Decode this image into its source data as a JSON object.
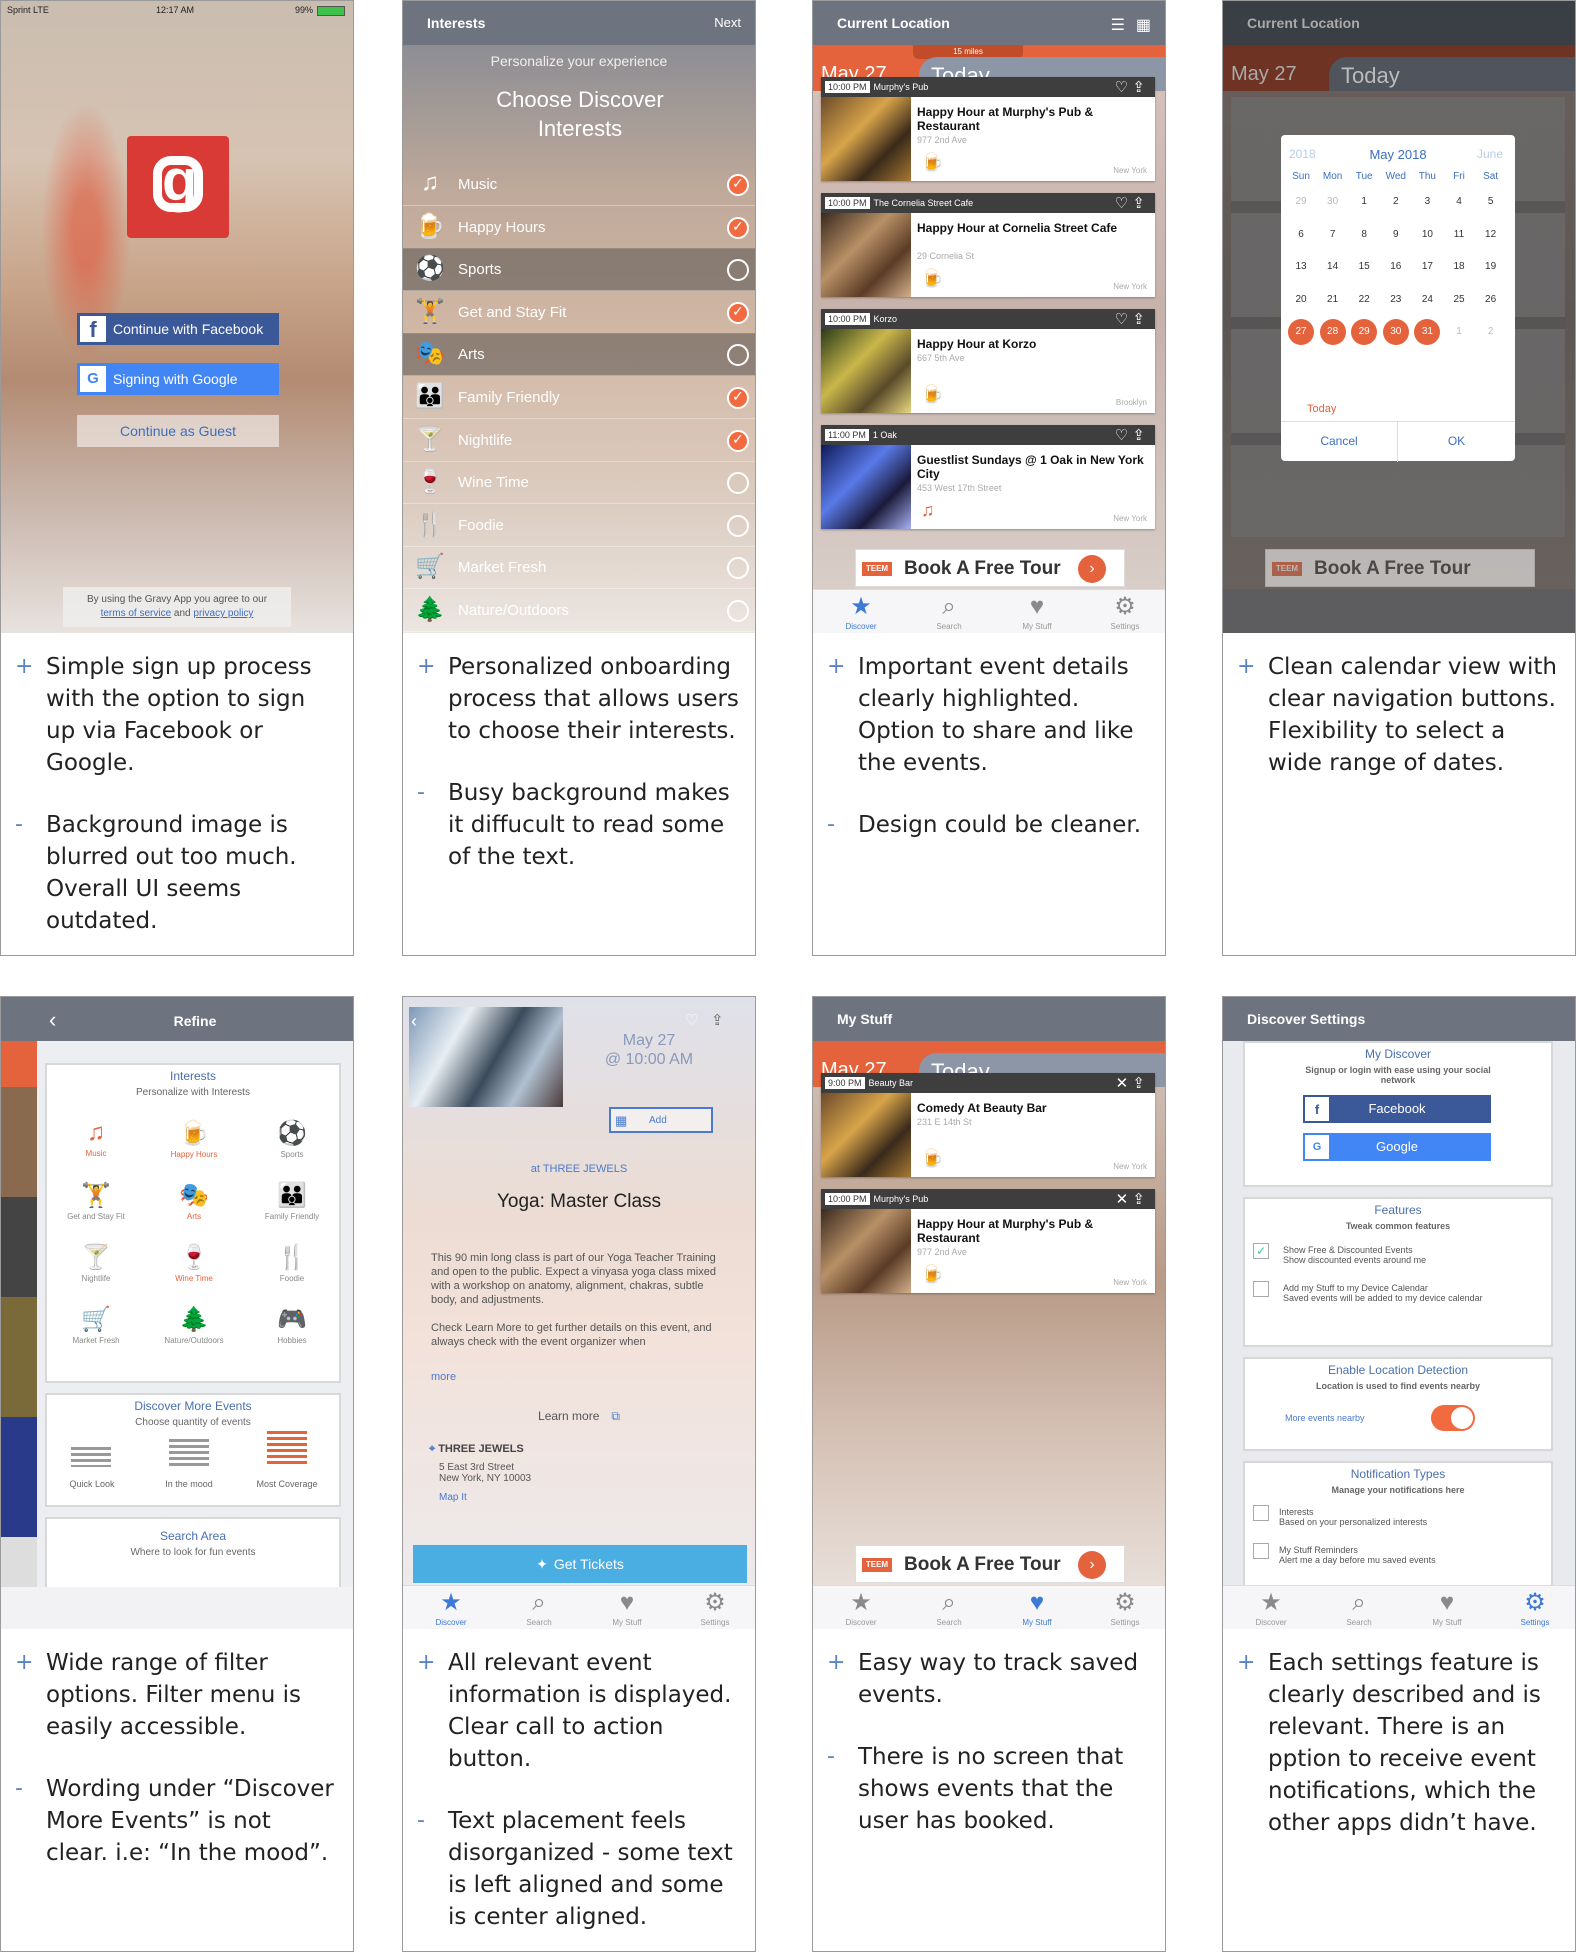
{
  "cards": [
    {
      "notes": [
        {
          "sym": "+",
          "text": "Simple sign up process with the option to sign up via Facebook or Google."
        },
        {
          "sym": "-",
          "text": "Background image is blurred out too much. Overall UI seems outdated."
        }
      ]
    },
    {
      "notes": [
        {
          "sym": "+",
          "text": "Personalized onboarding process that allows users to choose their interests."
        },
        {
          "sym": "-",
          "text": "Busy background makes it diffucult to read some of the text."
        }
      ]
    },
    {
      "notes": [
        {
          "sym": "+",
          "text": "Important event details clearly highlighted. Option to share and like the events."
        },
        {
          "sym": "-",
          "text": "Design could be cleaner."
        }
      ]
    },
    {
      "notes": [
        {
          "sym": "+",
          "text": "Clean calendar view with clear navigation buttons. Flexibility to select a wide range of dates."
        }
      ]
    },
    {
      "notes": [
        {
          "sym": "+",
          "text": "Wide range of filter options. Filter menu is easily accessible."
        },
        {
          "sym": "-",
          "text": "Wording under “Discover More Events” is not clear. i.e: “In the mood”."
        }
      ]
    },
    {
      "notes": [
        {
          "sym": "+",
          "text": "All relevant event information is displayed. Clear call to action button."
        },
        {
          "sym": "-",
          "text": "Text placement feels disorganized - some text is left aligned and some is center aligned."
        }
      ]
    },
    {
      "notes": [
        {
          "sym": "+",
          "text": "Easy way to track saved events."
        },
        {
          "sym": "-",
          "text": "There is no screen that shows events that the user has booked."
        }
      ]
    },
    {
      "notes": [
        {
          "sym": "+",
          "text": "Each settings feature is clearly described and is relevant. There is an pption to receive event notifications, which the other apps didn’t have."
        }
      ]
    }
  ],
  "s1": {
    "carrier": "Sprint  LTE",
    "time": "12:17 AM",
    "battery": "99%",
    "fb": "Continue with Facebook",
    "google": "Signing with Google",
    "guest": "Continue as Guest",
    "legal1": "By using the Gravy App you agree to our",
    "legal_tos": "terms of service",
    "legal_and": " and ",
    "legal_pp": "privacy policy"
  },
  "s2": {
    "title": "Interests",
    "next": "Next",
    "sub": "Personalize your experience",
    "head": "Choose Discover Interests",
    "items": [
      {
        "label": "Music",
        "icon": "♫",
        "on": true
      },
      {
        "label": "Happy Hours",
        "icon": "🍺",
        "on": true
      },
      {
        "label": "Sports",
        "icon": "⚽",
        "on": false
      },
      {
        "label": "Get and Stay Fit",
        "icon": "🏋",
        "on": true
      },
      {
        "label": "Arts",
        "icon": "🎭",
        "on": false
      },
      {
        "label": "Family Friendly",
        "icon": "👪",
        "on": true
      },
      {
        "label": "Nightlife",
        "icon": "🍸",
        "on": true
      },
      {
        "label": "Wine Time",
        "icon": "🍷",
        "on": false
      },
      {
        "label": "Foodie",
        "icon": "🍴",
        "on": false
      },
      {
        "label": "Market Fresh",
        "icon": "🛒",
        "on": false
      },
      {
        "label": "Nature/Outdoors",
        "icon": "🌲",
        "on": false
      }
    ]
  },
  "s3": {
    "title": "Current Location",
    "miles": "15 miles",
    "date": "May 27",
    "today": "Today",
    "events": [
      {
        "time": "10:00 PM",
        "venue": "Murphy's Pub",
        "title": "Happy Hour at Murphy's Pub & Restaurant",
        "addr": "977 2nd Ave",
        "loc": "New York"
      },
      {
        "time": "10:00 PM",
        "venue": "The Cornelia Street Cafe",
        "title": "Happy Hour at Cornelia Street Cafe",
        "addr": "29 Cornelia St",
        "loc": "New York"
      },
      {
        "time": "10:00 PM",
        "venue": "Korzo",
        "title": "Happy Hour at Korzo",
        "addr": "667 5th Ave",
        "loc": "Brooklyn"
      },
      {
        "time": "11:00 PM",
        "venue": "1 Oak",
        "title": "Guestlist Sundays @ 1 Oak in New York City",
        "addr": "453 West 17th Street",
        "loc": "New York"
      }
    ],
    "ad_logo": "TEEM",
    "ad": "Book A Free Tour",
    "tabs": [
      "Discover",
      "Search",
      "My Stuff",
      "Settings"
    ]
  },
  "s4": {
    "prev": "2018",
    "month": "May 2018",
    "next": "June",
    "days": [
      "Sun",
      "Mon",
      "Tue",
      "Wed",
      "Thu",
      "Fri",
      "Sat"
    ],
    "weeks": [
      [
        "29",
        "30",
        "1",
        "2",
        "3",
        "4",
        "5"
      ],
      [
        "6",
        "7",
        "8",
        "9",
        "10",
        "11",
        "12"
      ],
      [
        "13",
        "14",
        "15",
        "16",
        "17",
        "18",
        "19"
      ],
      [
        "20",
        "21",
        "22",
        "23",
        "24",
        "25",
        "26"
      ],
      [
        "27",
        "28",
        "29",
        "30",
        "31",
        "1",
        "2"
      ]
    ],
    "todaylink": "Today",
    "cancel": "Cancel",
    "ok": "OK"
  },
  "s5": {
    "title": "Refine",
    "interests": "Interests",
    "pers": "Personalize with Interests",
    "grid": [
      {
        "label": "Music",
        "icon": "♫",
        "on": true
      },
      {
        "label": "Happy Hours",
        "icon": "🍺",
        "on": true
      },
      {
        "label": "Sports",
        "icon": "⚽",
        "on": false
      },
      {
        "label": "Get and Stay Fit",
        "icon": "🏋",
        "on": false
      },
      {
        "label": "Arts",
        "icon": "🎭",
        "on": true
      },
      {
        "label": "Family Friendly",
        "icon": "👪",
        "on": false
      },
      {
        "label": "Nightlife",
        "icon": "🍸",
        "on": false
      },
      {
        "label": "Wine Time",
        "icon": "🍷",
        "on": true
      },
      {
        "label": "Foodie",
        "icon": "🍴",
        "on": false
      },
      {
        "label": "Market Fresh",
        "icon": "🛒",
        "on": false
      },
      {
        "label": "Nature/Outdoors",
        "icon": "🌲",
        "on": false
      },
      {
        "label": "Hobbies",
        "icon": "🎮",
        "on": false
      }
    ],
    "more": "Discover More Events",
    "qty": "Choose quantity of events",
    "q": [
      "Quick Look",
      "In the mood",
      "Most Coverage"
    ],
    "area": "Search Area",
    "areasub": "Where to look for fun events"
  },
  "s6": {
    "date": "May 27",
    "time": "@ 10:00 AM",
    "add": "Add",
    "at": "at THREE JEWELS",
    "title": "Yoga: Master Class",
    "desc1": "This 90 min long class is part of our Yoga Teacher Training and open to the public. Expect a vinyasa yoga class mixed with a workshop on anatomy, alignment, chakras, subtle body, and adjustments.",
    "desc2": "Check Learn More to get further details on this event, and always check with the event organizer when",
    "more": "more",
    "learn": "Learn more",
    "venue": "THREE JEWELS",
    "a1": "5 East 3rd Street",
    "a2": "New York, NY 10003",
    "map": "Map It",
    "tickets": "Get Tickets"
  },
  "s7": {
    "title": "My Stuff",
    "date": "May 27",
    "today": "Today",
    "events": [
      {
        "time": "9:00 PM",
        "venue": "Beauty Bar",
        "title": "Comedy At Beauty Bar",
        "addr": "231 E 14th St",
        "loc": "New York"
      },
      {
        "time": "10:00 PM",
        "venue": "Murphy's Pub",
        "title": "Happy Hour at Murphy's Pub & Restaurant",
        "addr": "977 2nd Ave",
        "loc": "New York"
      }
    ]
  },
  "s8": {
    "title": "Discover Settings",
    "mydisc": "My Discover",
    "mysub": "Signup or login with ease using your social network",
    "fb": "Facebook",
    "google": "Google",
    "feat": "Features",
    "featsub": "Tweak common features",
    "f1": "Show Free & Discounted  Events",
    "f1s": "Show discounted events around me",
    "f2": "Add my Stuff to my Device Calendar",
    "f2s": "Saved events will be added to my device calendar",
    "loc": "Enable Location Detection",
    "locsub": "Location is used to find events nearby",
    "locmore": "More events nearby",
    "notif": "Notification Types",
    "notifsub": "Manage your notifications here",
    "n1": "Interests",
    "n1s": "Based on your personalized interests",
    "n2": "My Stuff Reminders",
    "n2s": "Alert me a day before mu saved events"
  },
  "colors": {
    "accent": "#e4623c",
    "nav": "#6d7480",
    "blue": "#3c7ad6",
    "facebook": "#3b5998",
    "google": "#4285f4"
  }
}
